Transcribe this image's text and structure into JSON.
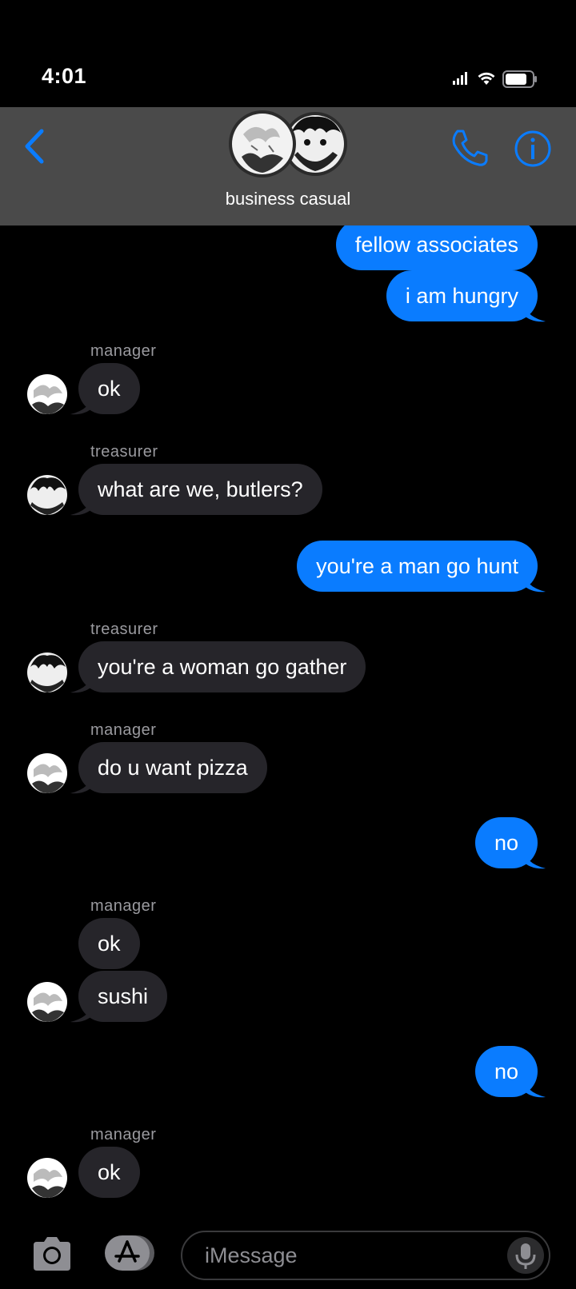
{
  "status": {
    "time": "4:01"
  },
  "header": {
    "title": "business casual"
  },
  "messages": [
    {
      "text": "fellow associates"
    },
    {
      "text": "i am hungry"
    },
    {
      "sender": "manager",
      "text": "ok"
    },
    {
      "sender": "treasurer",
      "text": "what are we, butlers?"
    },
    {
      "text": "you're a man go hunt"
    },
    {
      "sender": "treasurer",
      "text": "you're a woman go gather"
    },
    {
      "sender": "manager",
      "text": "do u want pizza"
    },
    {
      "text": "no"
    },
    {
      "sender": "manager",
      "text": "ok"
    },
    {
      "text": "sushi"
    },
    {
      "text": "no"
    },
    {
      "sender": "manager",
      "text": "ok"
    }
  ],
  "composer": {
    "placeholder": "iMessage"
  },
  "colors": {
    "outgoing": "#0a7cff",
    "incoming": "#26252a",
    "accent": "#0a7cff",
    "header_bg": "#4a4a4a"
  },
  "icons": [
    "back-icon",
    "phone-icon",
    "info-icon",
    "camera-icon",
    "app-store-icon",
    "microphone-icon",
    "signal-icon",
    "wifi-icon",
    "battery-icon"
  ]
}
